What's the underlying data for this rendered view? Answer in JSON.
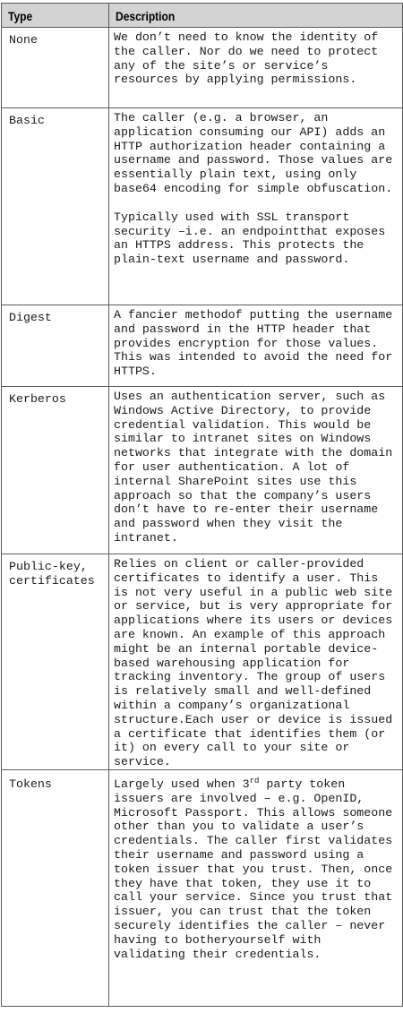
{
  "table": {
    "headers": {
      "type": "Type",
      "description": "Description"
    },
    "rows": [
      {
        "type": "None",
        "paragraphs": [
          "We don’t need to know the identity of the caller. Nor do we need to protect any of the site’s or service’s resources by applying permissions."
        ]
      },
      {
        "type": "Basic",
        "paragraphs": [
          "The caller (e.g. a browser, an application consuming our API) adds an HTTP authorization header containing a username and password. Those values are essentially plain text, using only base64 encoding for simple obfuscation.",
          "Typically used with SSL transport security –i.e. an endpointthat exposes an HTTPS address. This protects the plain-text username and password."
        ]
      },
      {
        "type": "Digest",
        "paragraphs": [
          "A fancier methodof putting the username and password in the HTTP header that provides encryption for those values. This was intended to avoid the need for HTTPS."
        ]
      },
      {
        "type": "Kerberos",
        "paragraphs": [
          "Uses an authentication server, such as Windows Active Directory, to provide credential validation. This would be similar to intranet sites on Windows networks that integrate with the domain for user authentication. A lot of internal SharePoint sites use this approach so that the company’s users don’t have to re-enter their username and password when they visit the intranet."
        ]
      },
      {
        "type": "Public-key, certificates",
        "paragraphs": [
          "Relies on client or caller-provided certificates to identify a user. This is not very useful in a public web site or service, but is very appropriate for applications where its users or devices are known. An example of this approach might be an internal portable device-based warehousing application for tracking inventory. The group of users is relatively small and well-defined within a company’s organizational structure.Each user or device is issued a certificate that identifies them (or it) on every call to your site or service."
        ]
      },
      {
        "type": "Tokens",
        "tokens_intro_pre": "Largely used when 3",
        "tokens_intro_sup": "rd",
        "tokens_intro_post": " party token issuers are involved – e.g. OpenID, Microsoft Passport. This allows someone other than you to validate a user’s credentials. The caller first validates their username and password using a token issuer that you trust. Then, once they have that token, they use it to call your service. Since you trust that issuer, you can trust that the token securely identifies the caller – never having to botheryourself with validating their credentials."
      }
    ]
  }
}
